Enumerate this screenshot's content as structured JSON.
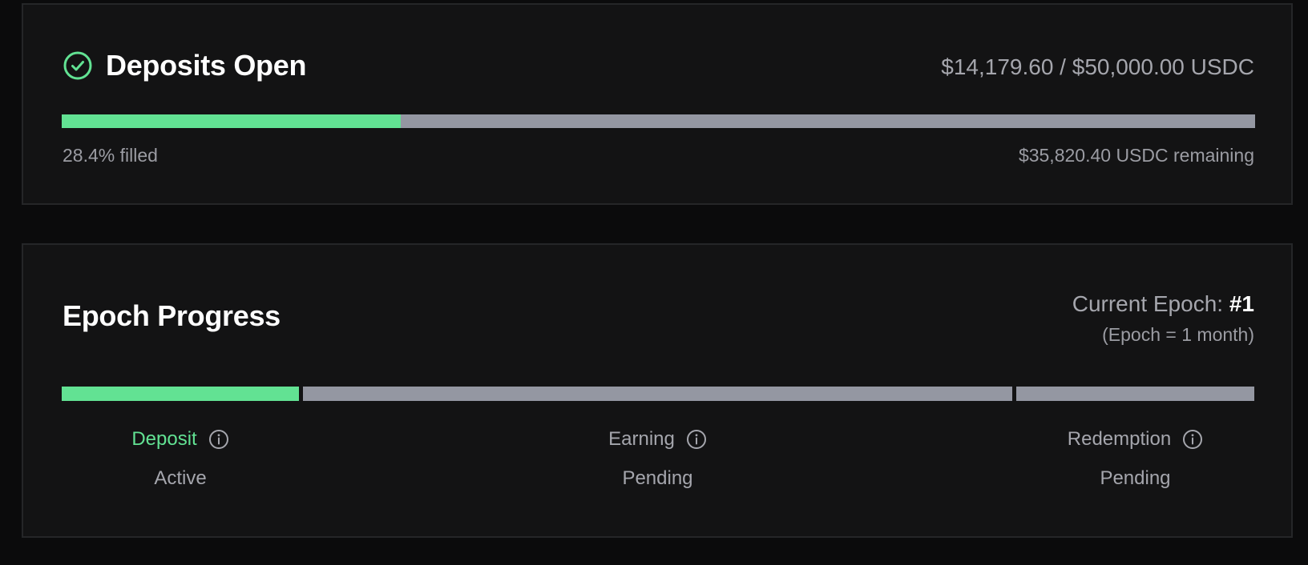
{
  "deposits": {
    "title": "Deposits Open",
    "status_icon": "check-circle-icon",
    "amount": "$14,179.60 / $50,000.00 USDC",
    "progress_percent": 28.4,
    "filled_label": "28.4% filled",
    "remaining_label": "$35,820.40 USDC remaining"
  },
  "epoch": {
    "title": "Epoch Progress",
    "current_label": "Current Epoch: ",
    "current_number": "#1",
    "note": "(Epoch = 1 month)",
    "phases": [
      {
        "label": "Deposit",
        "status": "Active",
        "active": true,
        "icon": "info-icon"
      },
      {
        "label": "Earning",
        "status": "Pending",
        "active": false,
        "icon": "info-icon"
      },
      {
        "label": "Redemption",
        "status": "Pending",
        "active": false,
        "icon": "info-icon"
      }
    ]
  },
  "colors": {
    "accent_green": "#62e293",
    "bar_gray": "#9497a2",
    "card_bg": "#131314",
    "page_bg": "#0b0b0c",
    "muted_text": "#a5a6ad"
  }
}
